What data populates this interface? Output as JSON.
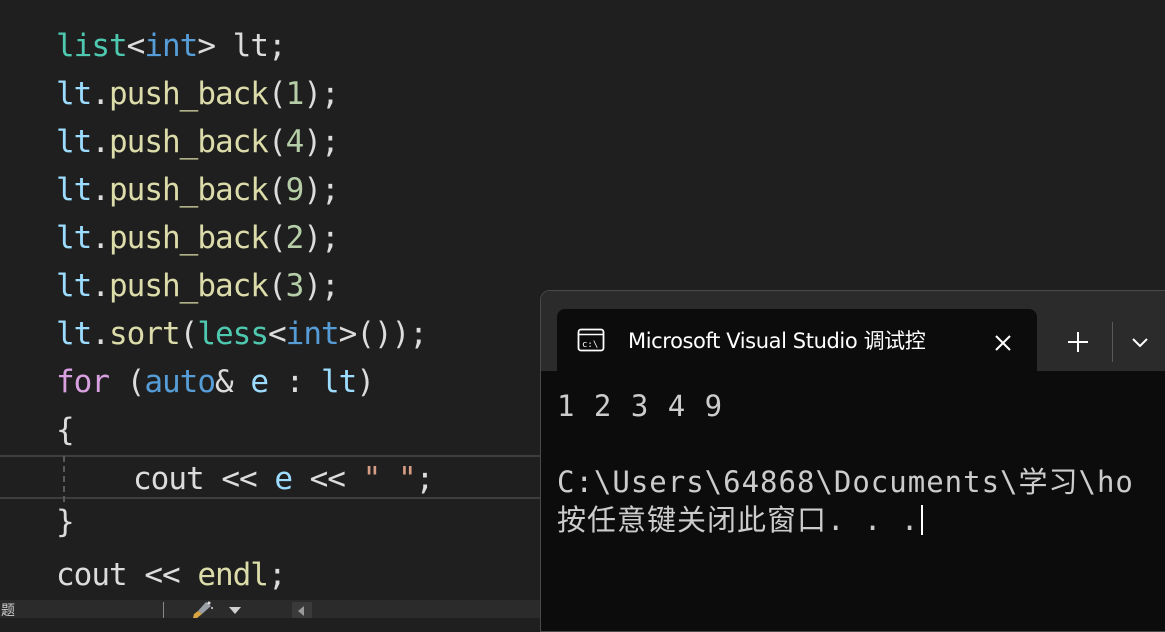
{
  "editor": {
    "lines": [
      {
        "t1": "list",
        "t2": "<",
        "t3": "int",
        "t4": "> lt;"
      },
      {
        "obj": "lt",
        "dot": ".",
        "fn": "push_back",
        "open": "(",
        "num": "1",
        "close": ");"
      },
      {
        "obj": "lt",
        "dot": ".",
        "fn": "push_back",
        "open": "(",
        "num": "4",
        "close": ");"
      },
      {
        "obj": "lt",
        "dot": ".",
        "fn": "push_back",
        "open": "(",
        "num": "9",
        "close": ");"
      },
      {
        "obj": "lt",
        "dot": ".",
        "fn": "push_back",
        "open": "(",
        "num": "2",
        "close": ");"
      },
      {
        "obj": "lt",
        "dot": ".",
        "fn": "push_back",
        "open": "(",
        "num": "3",
        "close": ");"
      },
      {
        "obj": "lt",
        "dot": ".",
        "fn": "sort",
        "open": "(",
        "less": "less",
        "lt": "<",
        "int": "int",
        "rest": ">());"
      },
      {
        "for": "for",
        "sp": " (",
        "auto": "auto",
        "amp": "& ",
        "e": "e",
        "colon": " : ",
        "lt": "lt",
        "close": ")"
      },
      {
        "brace": "{"
      },
      {
        "cout": "cout",
        "op1": " << ",
        "e": "e",
        "op2": " << ",
        "str": "\" \"",
        "semi": ";"
      },
      {
        "brace": "}"
      },
      {
        "cout": "cout",
        "op": " << ",
        "endl": "endl",
        "semi": ";"
      }
    ]
  },
  "statusbar": {
    "label": "问题"
  },
  "terminal": {
    "tab_title": "Microsoft Visual Studio 调试控",
    "output": [
      "1 2 3 4 9",
      "",
      "C:\\Users\\64868\\Documents\\学习\\ho",
      "按任意键关闭此窗口. . ."
    ]
  },
  "icons": {
    "console": "console-icon",
    "close": "close-icon",
    "new_tab": "plus-icon",
    "dropdown": "chevron-down-icon",
    "brush": "brush-icon"
  }
}
